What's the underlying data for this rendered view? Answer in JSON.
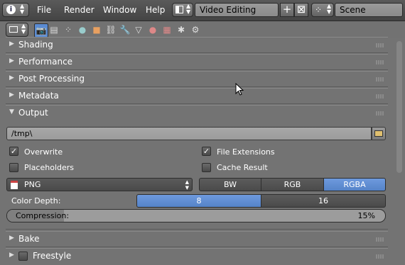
{
  "menubar": {
    "items": [
      "File",
      "Render",
      "Window",
      "Help"
    ],
    "screen_layout": "Video Editing",
    "scene": "Scene"
  },
  "properties_context": {
    "tabs": [
      "render-icon",
      "render-layers-icon",
      "scene-icon",
      "world-icon",
      "object-icon",
      "constraints-icon",
      "modifiers-icon",
      "data-icon",
      "material-icon",
      "texture-icon",
      "particles-icon",
      "physics-icon"
    ],
    "active_tab": "render-icon"
  },
  "panels": {
    "shading": "Shading",
    "performance": "Performance",
    "post_processing": "Post Processing",
    "metadata": "Metadata",
    "output": "Output",
    "bake": "Bake",
    "freestyle": "Freestyle"
  },
  "output": {
    "path": "/tmp\\",
    "overwrite": {
      "label": "Overwrite",
      "checked": true
    },
    "file_extensions": {
      "label": "File Extensions",
      "checked": true
    },
    "placeholders": {
      "label": "Placeholders",
      "checked": false
    },
    "cache_result": {
      "label": "Cache Result",
      "checked": false
    },
    "file_format": "PNG",
    "color_modes": [
      "BW",
      "RGB",
      "RGBA"
    ],
    "active_color_mode": "RGBA",
    "color_depth_label": "Color Depth:",
    "color_depth_options": [
      "8",
      "16"
    ],
    "active_color_depth": "8",
    "compression_label": "Compression:",
    "compression_value": "15%",
    "compression_fraction": 0.15
  },
  "freestyle_checked": false,
  "colors": {
    "accent": "#5a8bd2",
    "panel_bg": "#737373"
  }
}
